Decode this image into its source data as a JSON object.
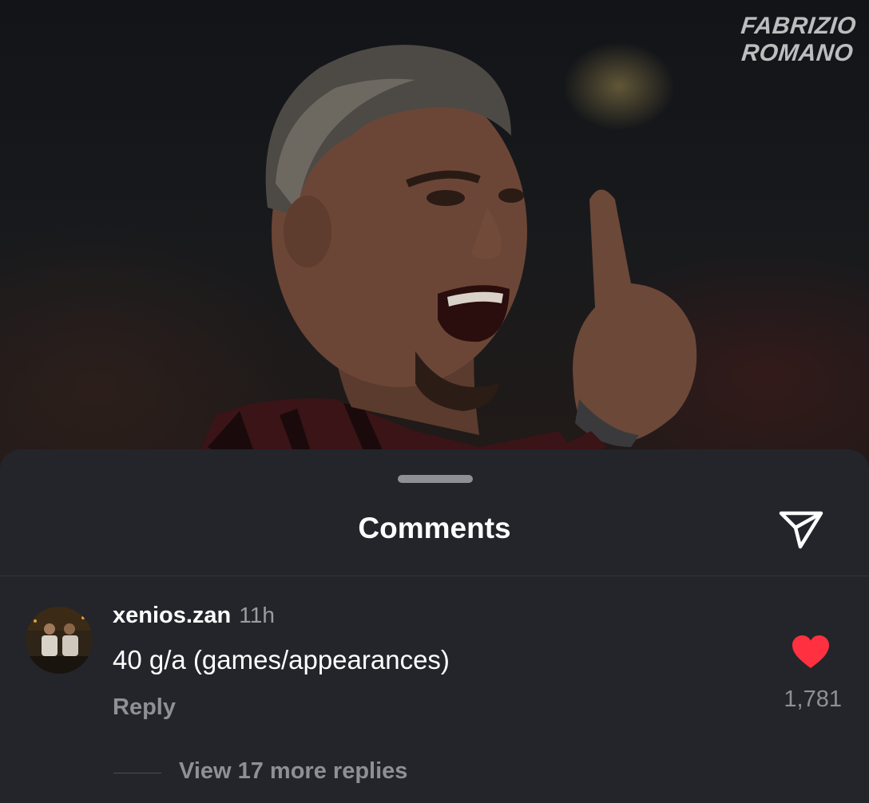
{
  "post": {
    "watermark_line1": "FABRIZIO",
    "watermark_line2": "ROMANO",
    "image_subject": "footballer-photo"
  },
  "sheet": {
    "title": "Comments",
    "share_icon": "paper-plane-icon"
  },
  "comment": {
    "username": "xenios.zan",
    "time": "11h",
    "text": "40 g/a (games/appearances)",
    "reply_label": "Reply",
    "like_icon": "heart-icon",
    "like_count": "1,781",
    "view_replies_label": "View 17 more replies"
  },
  "colors": {
    "sheet_background": "#23252a",
    "like_heart": "#ff3040",
    "muted_text": "#8e9096"
  }
}
